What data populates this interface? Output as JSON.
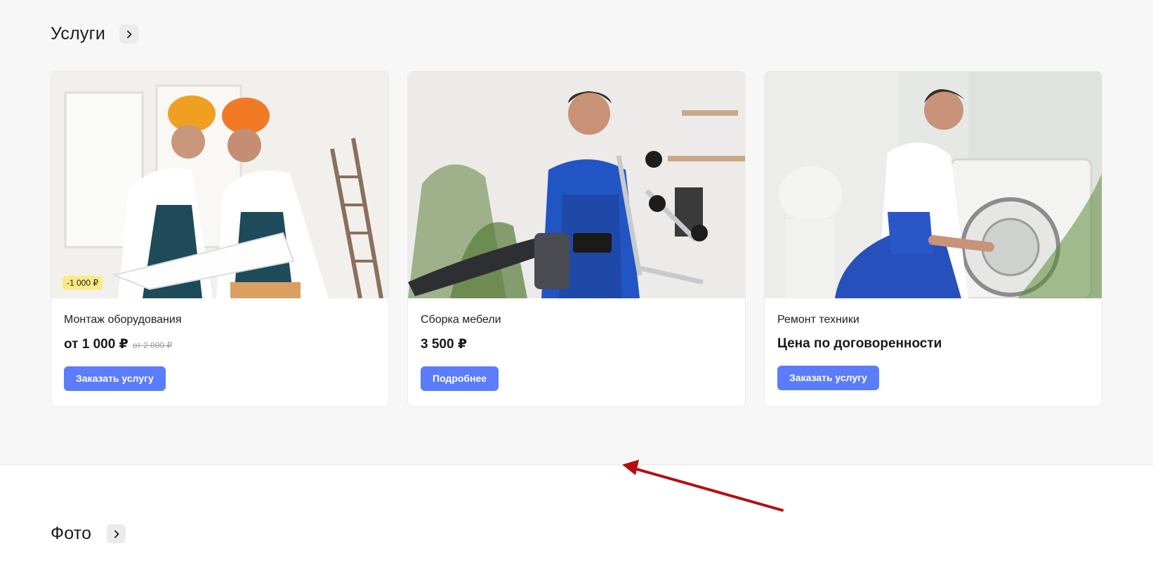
{
  "services_section": {
    "title": "Услуги",
    "arrow_icon": "chevron-right-icon",
    "cards": [
      {
        "image_alt": "Два монтажника в касках изучают чертёж",
        "badge": "-1 000 ₽",
        "title": "Монтаж оборудования",
        "price": "от 1 000 ₽",
        "old_price": "от 2 000 ₽",
        "button": "Заказать услугу"
      },
      {
        "image_alt": "Мастер в синем комбинезоне собирает кресло",
        "title": "Сборка мебели",
        "price": "3 500 ₽",
        "button": "Подробнее"
      },
      {
        "image_alt": "Мастер ремонтирует стиральную машину",
        "title": "Ремонт техники",
        "price": "Цена по договоренности",
        "button": "Заказать услугу"
      }
    ]
  },
  "photo_section": {
    "title": "Фото",
    "arrow_icon": "chevron-right-icon"
  },
  "colors": {
    "accent": "#5b7cfb",
    "badge": "#fbe985",
    "section_bg": "#f7f7f7",
    "annotation_arrow": "#b30f0f"
  }
}
